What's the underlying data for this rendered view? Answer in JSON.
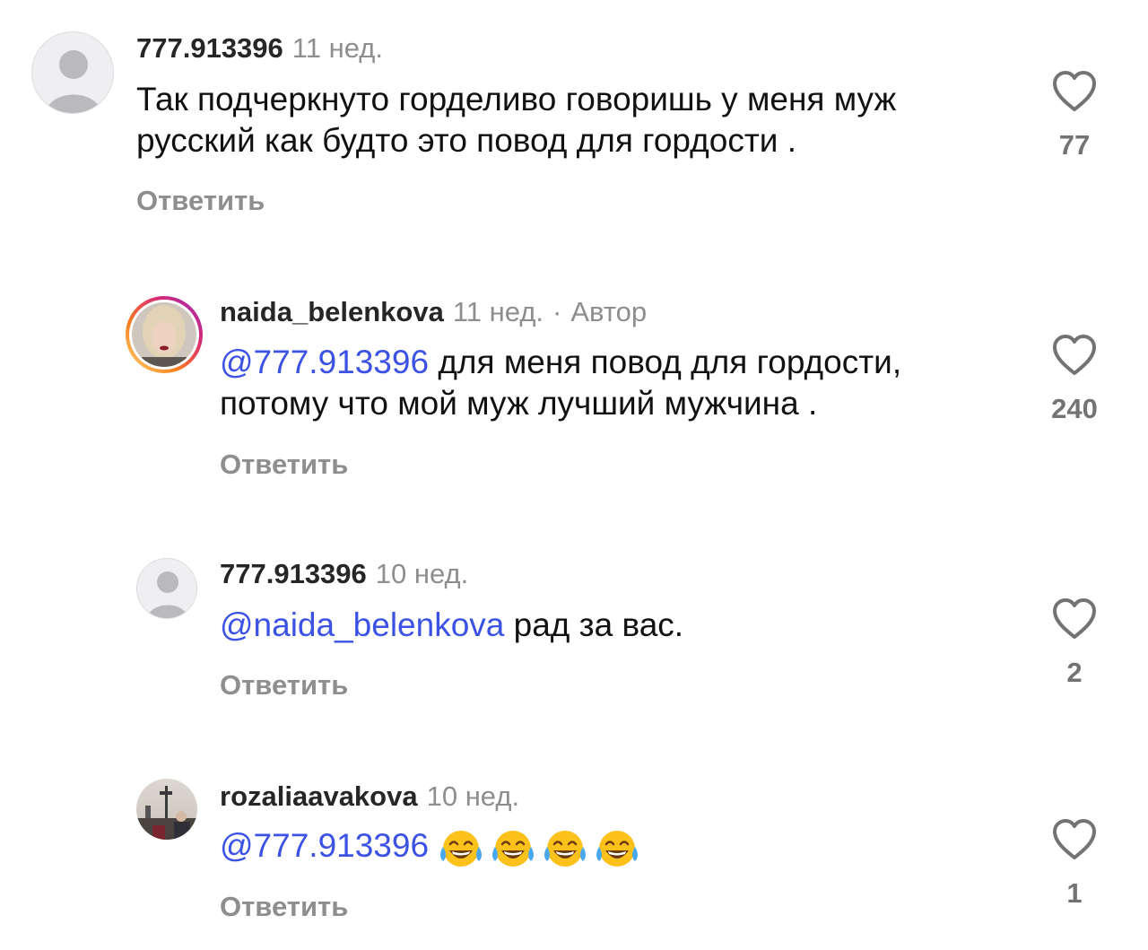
{
  "comments": [
    {
      "username": "777.913396",
      "time": "11 нед.",
      "text": "Так подчеркнуто горделиво говоришь у меня муж русский как будто это повод для гордости .",
      "reply_label": "Ответить",
      "likes": "77"
    },
    {
      "username": "naida_belenkova",
      "time": "11 нед.",
      "separator": "·",
      "author_badge": "Автор",
      "mention": "@777.913396",
      "text": "для меня повод для гордости, потому что мой муж лучший мужчина .",
      "reply_label": "Ответить",
      "likes": "240"
    },
    {
      "username": "777.913396",
      "time": "10 нед.",
      "mention": "@naida_belenkova",
      "text": "рад за вас.",
      "reply_label": "Ответить",
      "likes": "2"
    },
    {
      "username": "rozaliaavakova",
      "time": "10 нед.",
      "mention": "@777.913396",
      "emojis": [
        "face-with-tears-of-joy",
        "face-with-tears-of-joy",
        "face-with-tears-of-joy",
        "face-with-tears-of-joy"
      ],
      "reply_label": "Ответить",
      "likes": "1"
    }
  ],
  "colors": {
    "mention": "#3b52e4",
    "meta": "#8e8e8e",
    "story_ring": [
      "#feda75",
      "#fa7e1e",
      "#d62976",
      "#962fbf"
    ]
  },
  "icons": {
    "like": "heart-outline-icon",
    "default_avatar": "person-silhouette-icon"
  }
}
